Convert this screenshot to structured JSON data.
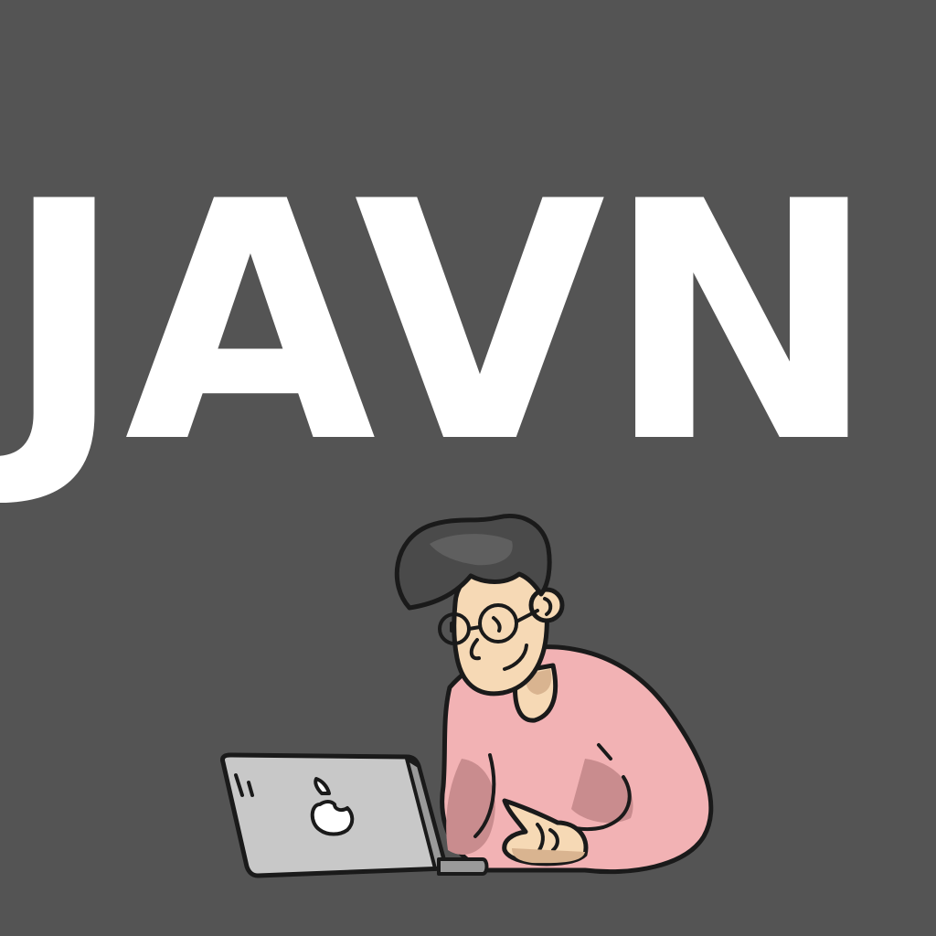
{
  "title": {
    "text": "JAVN"
  },
  "colors": {
    "background": "#545454",
    "title": "#ffffff",
    "outline": "#1a1a1a",
    "hair": "#4a4a4a",
    "hair_highlight": "#5f5f5f",
    "skin": "#f6d9b5",
    "skin_shadow": "#d9b490",
    "shirt": "#f2b2b4",
    "shirt_shadow": "#c98c8e",
    "laptop": "#c8c8c8",
    "laptop_edge": "#9a9a9a",
    "laptop_logo": "#ffffff"
  },
  "illustration": {
    "subject": "person-using-laptop",
    "laptop_logo_icon": "apple-logo-icon"
  }
}
